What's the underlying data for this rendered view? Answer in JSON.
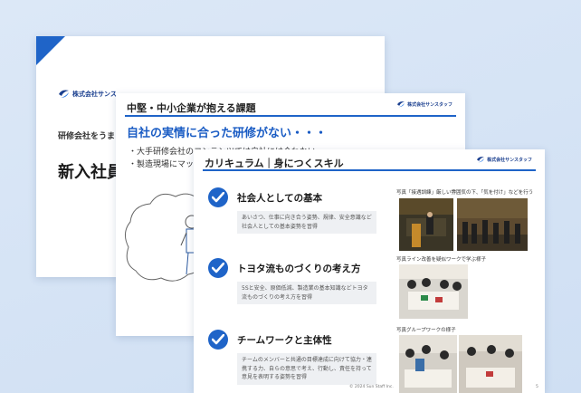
{
  "slide1": {
    "logo_text": "株式会社サンス",
    "subtitle": "研修会社をうま",
    "title": "新入社員"
  },
  "slide2": {
    "header": "中堅・中小企業が抱える課題",
    "logo_text": "株式会社サンスタッフ",
    "headline": "自社の実情に合った研修がない・・・",
    "bullets": [
      "・大手研修会社のコンテンツでは自社には合わない・・・",
      "・製造現場にマッ"
    ]
  },
  "slide3": {
    "header": "カリキュラム｜身につくスキル",
    "logo_text": "株式会社サンスタッフ",
    "items": [
      {
        "title": "社会人としての基本",
        "desc": "あいさつ、仕事に向き合う姿勢、規律、安全意識など社会人としての基本姿勢を習得"
      },
      {
        "title": "トヨタ流ものづくりの考え方",
        "desc": "5Sと安全、原価低減、製造業の基本知識などトヨタ流ものづくりの考え方を習得"
      },
      {
        "title": "チームワークと主体性",
        "desc": "チームのメンバーと共通の目標達成に向けて協力・連携する力、自らの意思で考え、行動し、責任を持って意見を表明する姿勢を習得"
      }
    ],
    "captions": [
      "写真「接遇訓練」厳しい雰囲気の下、「気を付け」などを行う",
      "写真ライン改善を疑似ワークで学ぶ様子",
      "写真グループワークの様子"
    ],
    "footer": "© 2024 Sun Staff Inc.",
    "page_number": "5"
  },
  "colors": {
    "accent": "#1f64c8",
    "headline": "#1a5cc4"
  }
}
